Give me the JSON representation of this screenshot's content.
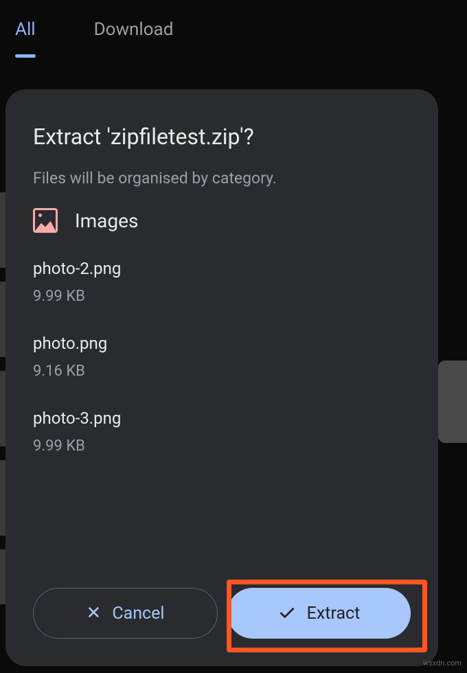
{
  "tabs": {
    "all": "All",
    "download": "Download"
  },
  "dialog": {
    "title": "Extract 'zipfiletest.zip'?",
    "subtitle": "Files will be organised by category.",
    "category": {
      "label": "Images"
    },
    "files": [
      {
        "name": "photo-2.png",
        "size": "9.99 KB"
      },
      {
        "name": "photo.png",
        "size": "9.16 KB"
      },
      {
        "name": "photo-3.png",
        "size": "9.99 KB"
      }
    ],
    "buttons": {
      "cancel": "Cancel",
      "extract": "Extract"
    }
  },
  "watermark": "wsxdn.com"
}
